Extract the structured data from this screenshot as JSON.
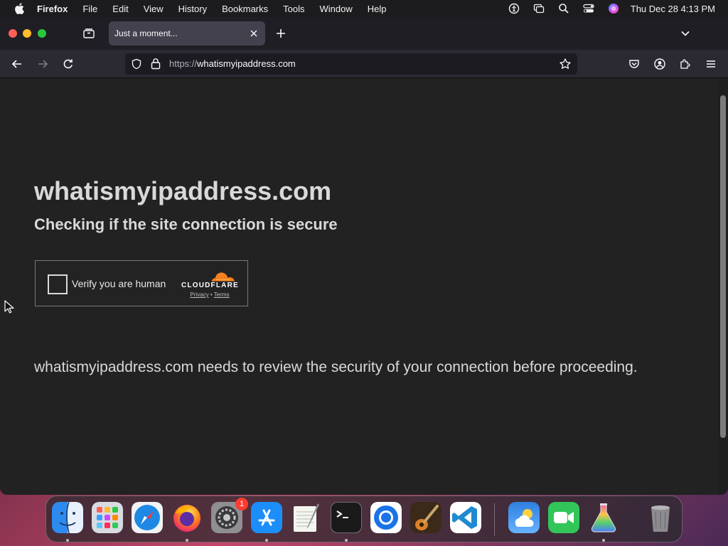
{
  "menubar": {
    "app_name": "Firefox",
    "items": [
      "File",
      "Edit",
      "View",
      "History",
      "Bookmarks",
      "Tools",
      "Window",
      "Help"
    ],
    "clock": "Thu Dec 28  4:13 PM",
    "status_icons": [
      "accessibility-icon",
      "screen-mirroring-icon",
      "spotlight-search-icon",
      "control-center-icon",
      "siri-icon"
    ]
  },
  "browser": {
    "tab_title": "Just a moment...",
    "url_scheme": "https://",
    "url_host": "whatismyipaddress.com"
  },
  "page": {
    "title": "whatismyipaddress.com",
    "subtitle": "Checking if the site connection is secure",
    "captcha": {
      "checkbox_label": "Verify you are human",
      "brand": "CLOUDFLARE",
      "privacy_link": "Privacy",
      "separator": "•",
      "terms_link": "Terms"
    },
    "review_message": "whatismyipaddress.com needs to review the security of your connection before proceeding."
  },
  "dock": {
    "apps": [
      "finder-icon",
      "launchpad-icon",
      "safari-icon",
      "firefox-icon",
      "system-settings-icon",
      "app-store-icon",
      "textedit-icon",
      "terminal-icon",
      "chromium-icon",
      "garageband-icon",
      "vscode-icon",
      "weather-icon",
      "facetime-icon",
      "gemini-icon",
      "trash-icon"
    ],
    "settings_badge": "1"
  },
  "colors": {
    "cloudflare_orange": "#f38020",
    "badge_red": "#ff3b30",
    "page_background": "#222222"
  }
}
